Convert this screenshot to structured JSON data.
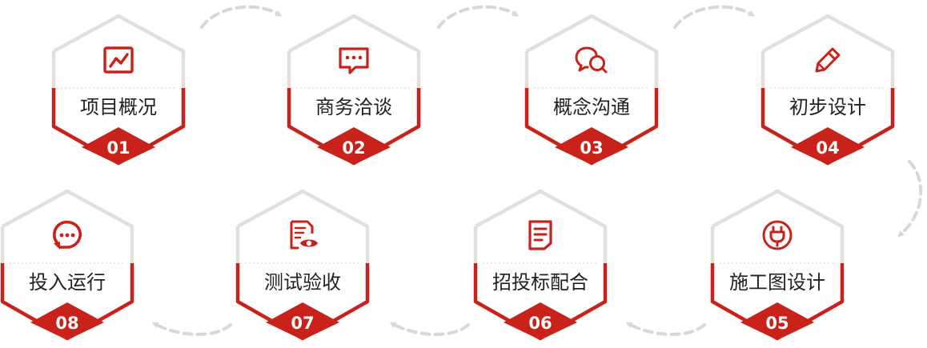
{
  "colors": {
    "accent": "#c9221a",
    "outline": "#e4dfdd",
    "arrow": "#d8d8d8",
    "text": "#222222"
  },
  "steps": [
    {
      "num": "01",
      "label": "项目概况",
      "icon": "chart-icon"
    },
    {
      "num": "02",
      "label": "商务洽谈",
      "icon": "message-icon"
    },
    {
      "num": "03",
      "label": "概念沟通",
      "icon": "chat-bubbles-icon"
    },
    {
      "num": "04",
      "label": "初步设计",
      "icon": "pencil-icon"
    },
    {
      "num": "05",
      "label": "施工图设计",
      "icon": "plug-icon"
    },
    {
      "num": "06",
      "label": "招投标配合",
      "icon": "document-icon"
    },
    {
      "num": "07",
      "label": "测试验收",
      "icon": "file-eye-icon"
    },
    {
      "num": "08",
      "label": "投入运行",
      "icon": "refresh-chat-icon"
    }
  ]
}
